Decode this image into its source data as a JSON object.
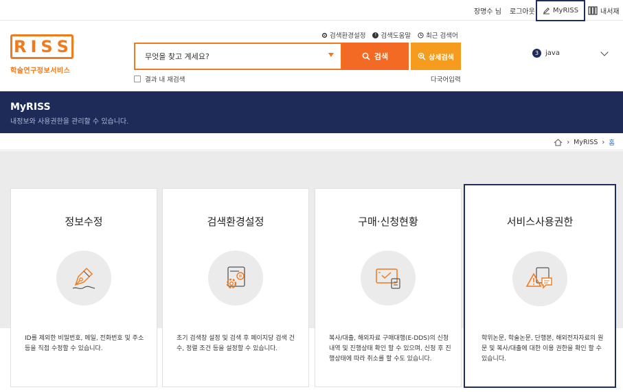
{
  "topbar": {
    "user": "장명수 님",
    "logout": "로그아웃",
    "myriss": "MyRISS",
    "mylibrary": "내서재"
  },
  "logo": {
    "letters": [
      "R",
      "I",
      "S",
      "S"
    ],
    "subtitle": "학술연구정보서비스"
  },
  "header_links": {
    "search_settings": "검색환경설정",
    "search_help": "검색도움말",
    "recent": "최근 검색어"
  },
  "search": {
    "placeholder": "무엇을 찾고 계세요?",
    "button": "검색",
    "advanced": "상세검색",
    "research_in_results": "결과 내 재검색",
    "multilang": "다국어입력"
  },
  "user_select": {
    "badge": "3",
    "name": "java"
  },
  "banner": {
    "title": "MyRISS",
    "subtitle": "내정보와 사용권한을 관리할 수 있습니다."
  },
  "breadcrumb": {
    "items": [
      "MyRISS",
      "홈"
    ]
  },
  "cards": [
    {
      "title": "정보수정",
      "desc": "ID를 제외한 비밀번호, 메일, 전화번호 및 주소 등을 직접 수정할 수 있습니다."
    },
    {
      "title": "검색환경설정",
      "desc": "초기 검색창 설정 및 검색 후 페이지당 검색 건수, 정렬 조건 등을 설정할 수 있습니다."
    },
    {
      "title": "구매·신청현황",
      "desc": "복사/대출, 해외자료 구매대행(E-DDS)의 신청내역 및 진행상태 확인 할 수 있으며, 신청 후 진행상태에 따라 취소를 할 수도 있습니다."
    },
    {
      "title": "서비스사용권한",
      "desc": "학위논문, 학술논문, 단행본, 해외전자자료의 원문 및 복사/대출에 대한 이용 권한을 확인 할 수 있습니다."
    }
  ],
  "colors": {
    "brand_orange": "#f07a1c",
    "navy": "#1e2b58"
  }
}
